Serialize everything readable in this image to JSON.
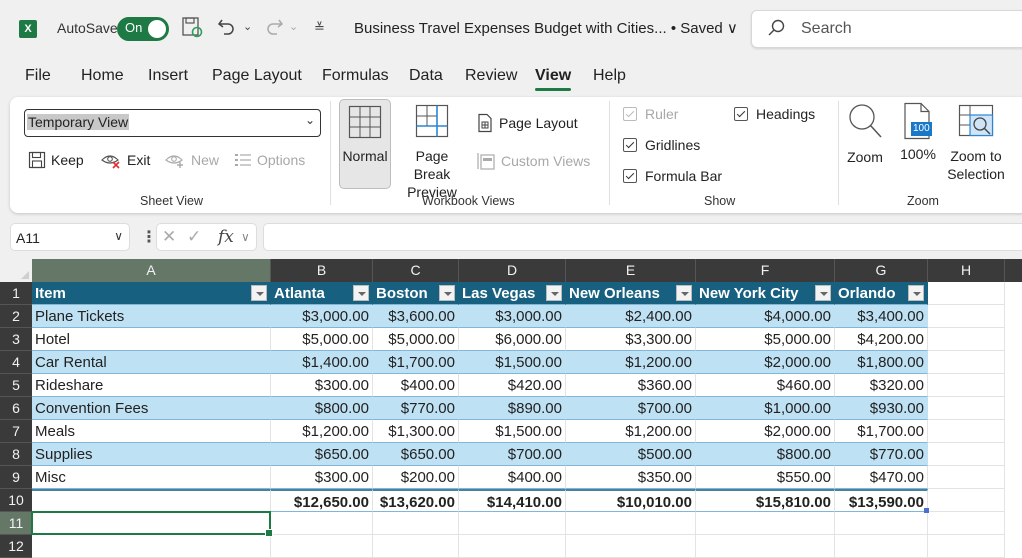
{
  "titlebar": {
    "app_icon": "excel-logo-icon",
    "app_letter": "X",
    "autosave_label": "AutoSave",
    "autosave_state": "On",
    "doc_title": "Business Travel Expenses Budget with Cities... • Saved ∨",
    "search_placeholder": "Search"
  },
  "tabs": [
    "File",
    "Home",
    "Insert",
    "Page Layout",
    "Formulas",
    "Data",
    "Review",
    "View",
    "Help"
  ],
  "active_tab": "View",
  "ribbon": {
    "sheet_view": {
      "label": "Sheet View",
      "selected_view": "Temporary View",
      "keep": "Keep",
      "exit": "Exit",
      "new": "New",
      "options": "Options"
    },
    "workbook_views": {
      "label": "Workbook Views",
      "normal": "Normal",
      "page_break_1": "Page Break",
      "page_break_2": "Preview",
      "page_layout": "Page Layout",
      "custom_views": "Custom Views"
    },
    "show": {
      "label": "Show",
      "ruler": "Ruler",
      "headings": "Headings",
      "gridlines": "Gridlines",
      "formula_bar": "Formula Bar"
    },
    "zoom": {
      "label": "Zoom",
      "zoom": "Zoom",
      "hundred": "100%",
      "hundred_badge": "100",
      "zoom_sel_1": "Zoom to",
      "zoom_sel_2": "Selection"
    }
  },
  "formula_bar": {
    "name_box": "A11",
    "fx": "fx",
    "formula": ""
  },
  "sheet": {
    "columns": [
      "A",
      "B",
      "C",
      "D",
      "E",
      "F",
      "G",
      "H"
    ],
    "rows": [
      "1",
      "2",
      "3",
      "4",
      "5",
      "6",
      "7",
      "8",
      "9",
      "10",
      "11",
      "12"
    ],
    "header": [
      "Item",
      "Atlanta",
      "Boston",
      "Las Vegas",
      "New Orleans",
      "New York City",
      "Orlando"
    ],
    "data": [
      [
        "Plane Tickets",
        "$3,000.00",
        "$3,600.00",
        "$3,000.00",
        "$2,400.00",
        "$4,000.00",
        "$3,400.00"
      ],
      [
        "Hotel",
        "$5,000.00",
        "$5,000.00",
        "$6,000.00",
        "$3,300.00",
        "$5,000.00",
        "$4,200.00"
      ],
      [
        "Car Rental",
        "$1,400.00",
        "$1,700.00",
        "$1,500.00",
        "$1,200.00",
        "$2,000.00",
        "$1,800.00"
      ],
      [
        "Rideshare",
        "$300.00",
        "$400.00",
        "$420.00",
        "$360.00",
        "$460.00",
        "$320.00"
      ],
      [
        "Convention Fees",
        "$800.00",
        "$770.00",
        "$890.00",
        "$700.00",
        "$1,000.00",
        "$930.00"
      ],
      [
        "Meals",
        "$1,200.00",
        "$1,300.00",
        "$1,500.00",
        "$1,200.00",
        "$2,000.00",
        "$1,700.00"
      ],
      [
        "Supplies",
        "$650.00",
        "$650.00",
        "$700.00",
        "$500.00",
        "$800.00",
        "$770.00"
      ],
      [
        "Misc",
        "$300.00",
        "$200.00",
        "$400.00",
        "$350.00",
        "$550.00",
        "$470.00"
      ]
    ],
    "totals": [
      "",
      "$12,650.00",
      "$13,620.00",
      "$14,410.00",
      "$10,010.00",
      "$15,810.00",
      "$13,590.00"
    ],
    "active_cell": "A11",
    "colors": {
      "header_bg": "#17607f",
      "band_bg": "#bfe1f4",
      "accent": "#1d7a44"
    }
  }
}
